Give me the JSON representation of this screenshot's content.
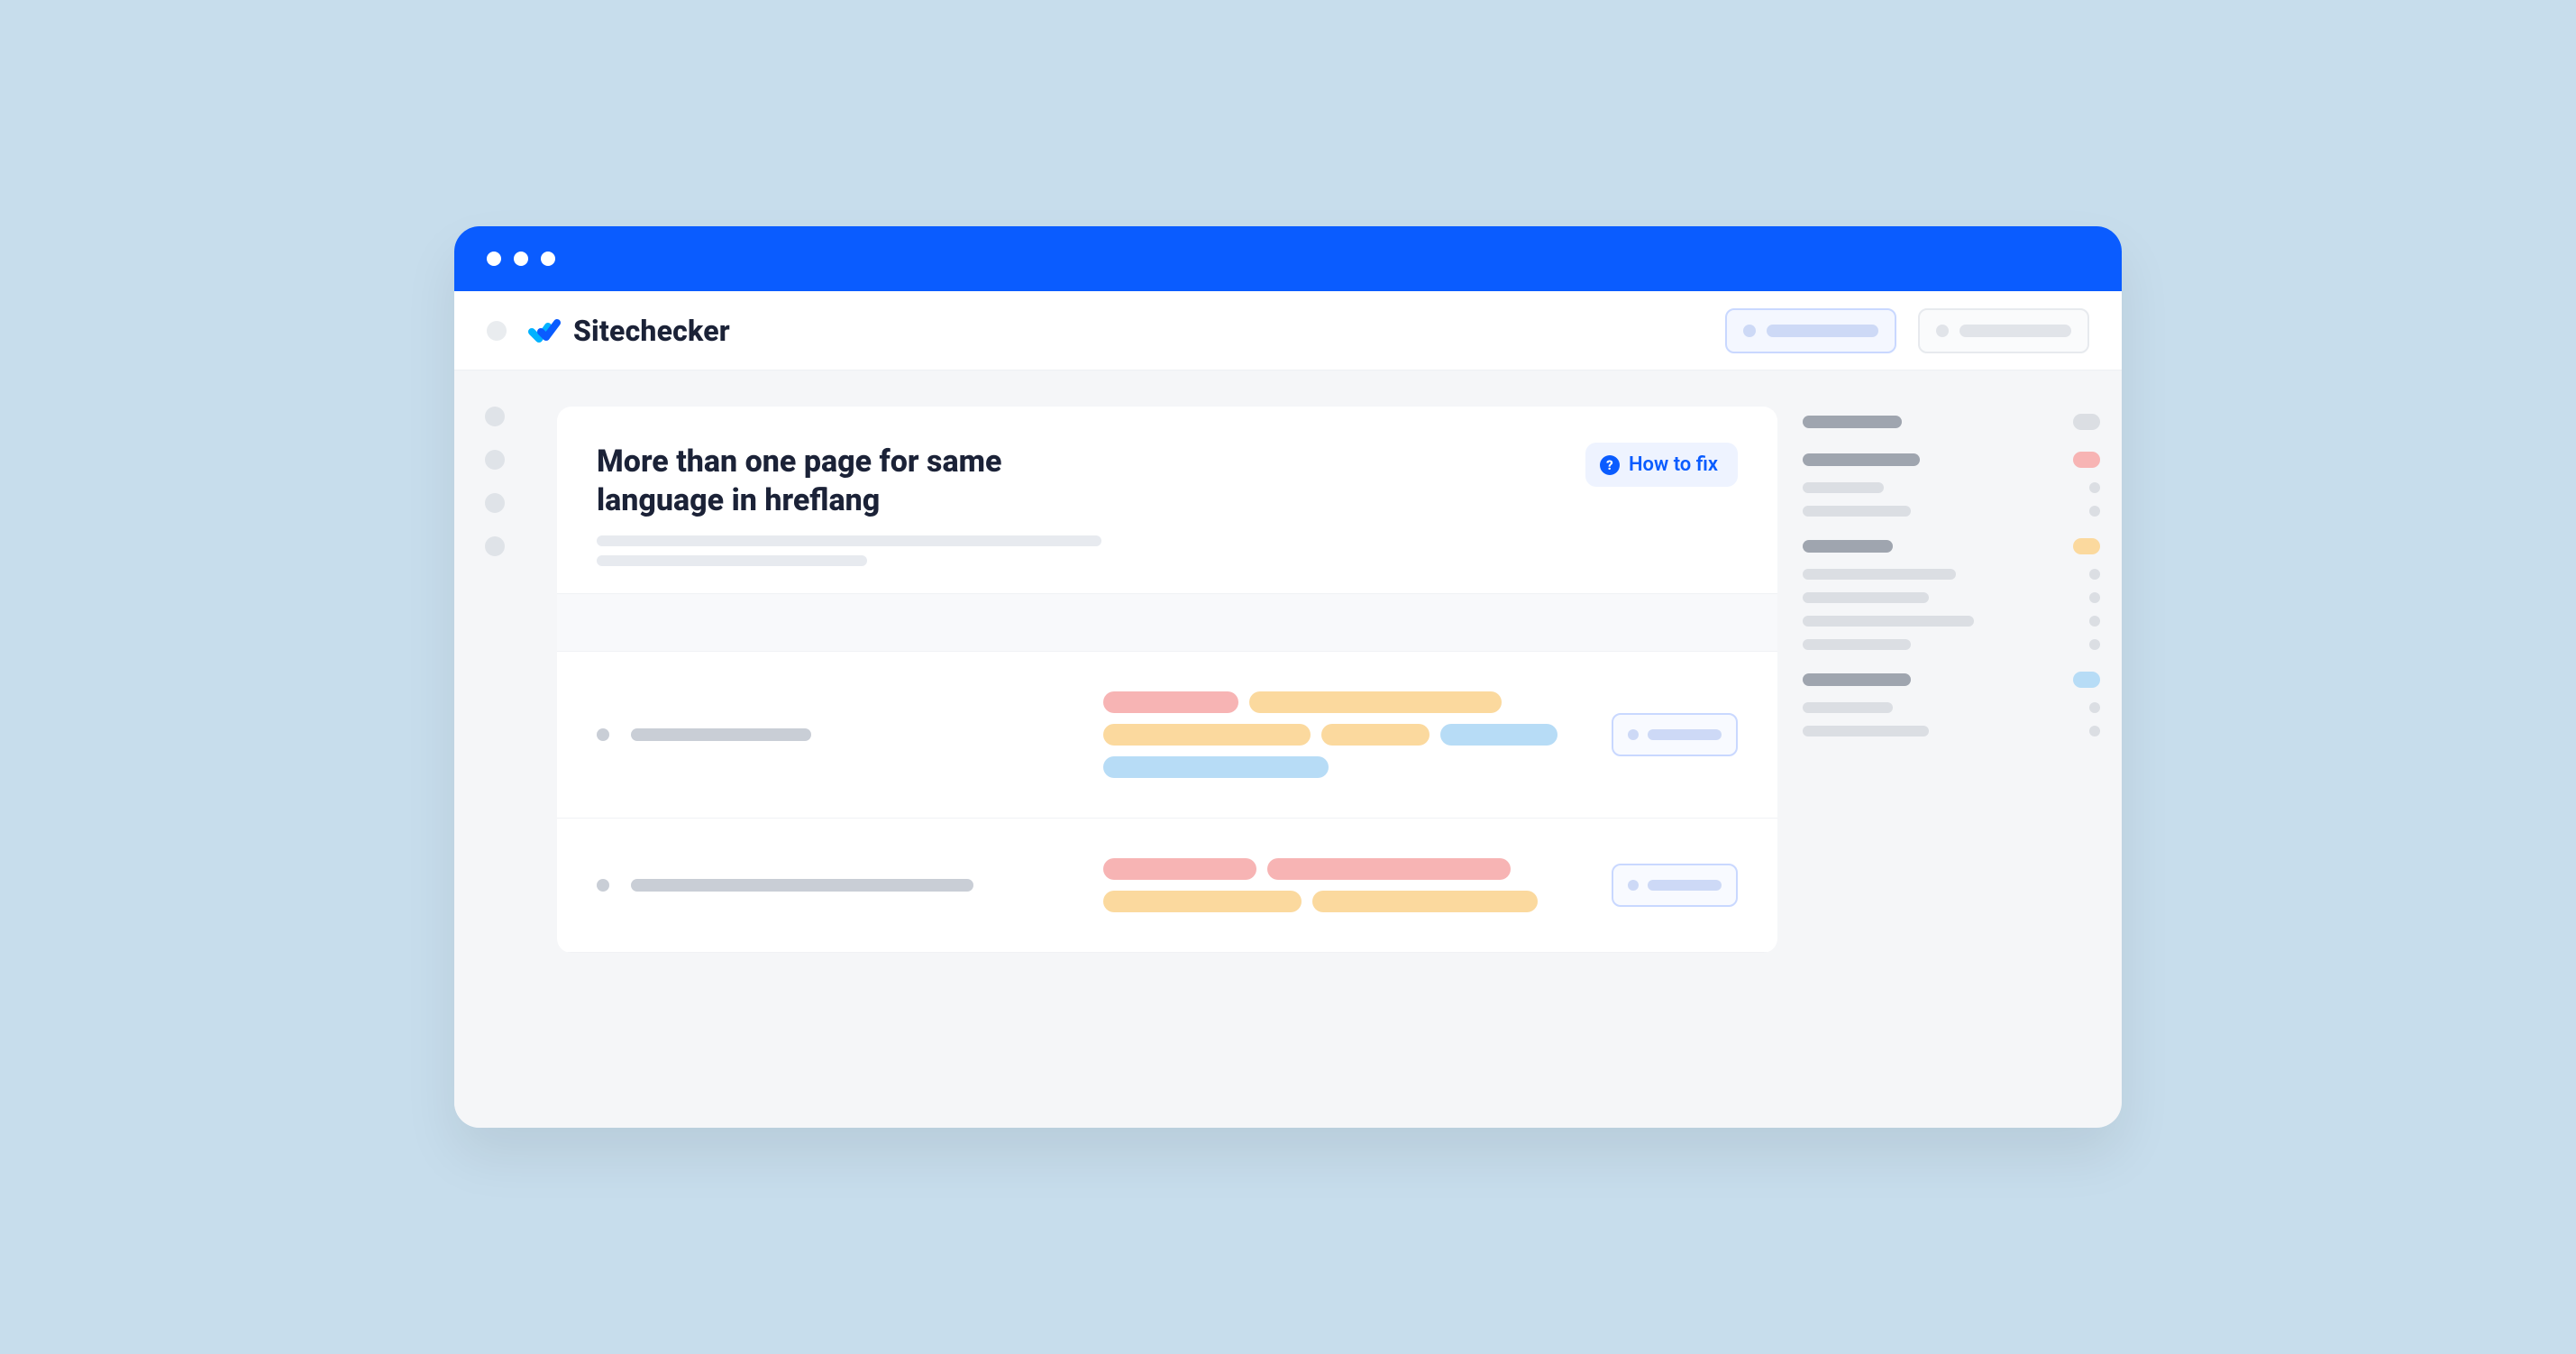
{
  "brand": {
    "name": "Sitechecker"
  },
  "card": {
    "title": "More than one page for same language in hreflang",
    "howto_label": "How to fix"
  }
}
